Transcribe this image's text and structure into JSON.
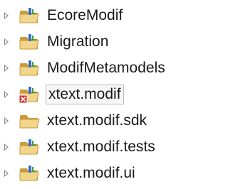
{
  "tree": {
    "items": [
      {
        "label": "EcoreModif",
        "icon": "plugin-project-folder-icon",
        "selected": false
      },
      {
        "label": "Migration",
        "icon": "plugin-project-folder-icon",
        "selected": false
      },
      {
        "label": "ModifMetamodels",
        "icon": "plugin-project-folder-icon",
        "selected": false
      },
      {
        "label": "xtext.modif",
        "icon": "plugin-project-folder-error-icon",
        "selected": true
      },
      {
        "label": "xtext.modif.sdk",
        "icon": "plain-project-folder-icon",
        "selected": false
      },
      {
        "label": "xtext.modif.tests",
        "icon": "plugin-project-folder-icon",
        "selected": false
      },
      {
        "label": "xtext.modif.ui",
        "icon": "plugin-project-folder-icon",
        "selected": false
      }
    ]
  },
  "colors": {
    "folder_body": "#d9b25a",
    "folder_tab": "#c99a3e",
    "folder_front": "#f1d58a",
    "plugin_blue": "#2f6fc4",
    "plugin_green": "#3f9b3f",
    "error_red": "#d42a2a",
    "twisty": "#8a8a8a"
  }
}
